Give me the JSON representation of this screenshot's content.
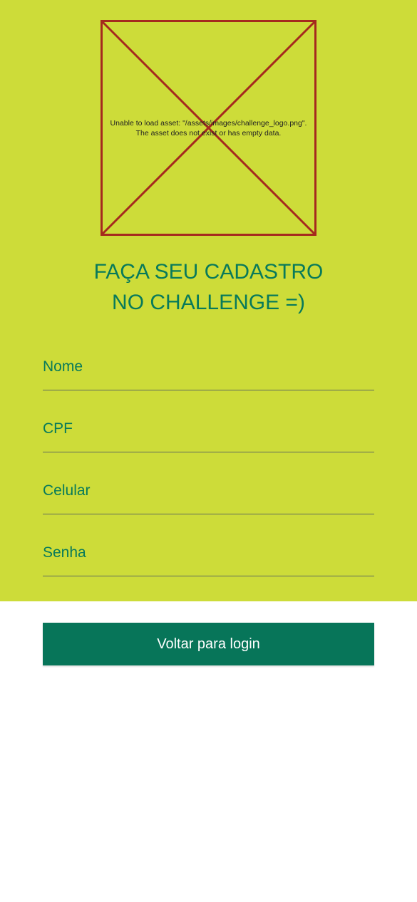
{
  "logo": {
    "icon": "broken-image-icon",
    "error_line_1": "Unable to load asset: \"/assets/images/challenge_logo.png\".",
    "error_line_2": "The asset does not exist or has empty data.",
    "border_color": "#a52a1e"
  },
  "headline": {
    "line_1": "FAÇA SEU CADASTRO",
    "line_2": "NO CHALLENGE =)"
  },
  "form": {
    "fields": [
      {
        "label": "Nome",
        "value": ""
      },
      {
        "label": "CPF",
        "value": ""
      },
      {
        "label": "Celular",
        "value": ""
      },
      {
        "label": "Senha",
        "value": ""
      }
    ]
  },
  "actions": {
    "back_label": "Voltar para login"
  },
  "colors": {
    "top_background": "#cddc39",
    "accent_green": "#087a5a",
    "button_green": "#077559",
    "page_background": "#ffffff"
  }
}
